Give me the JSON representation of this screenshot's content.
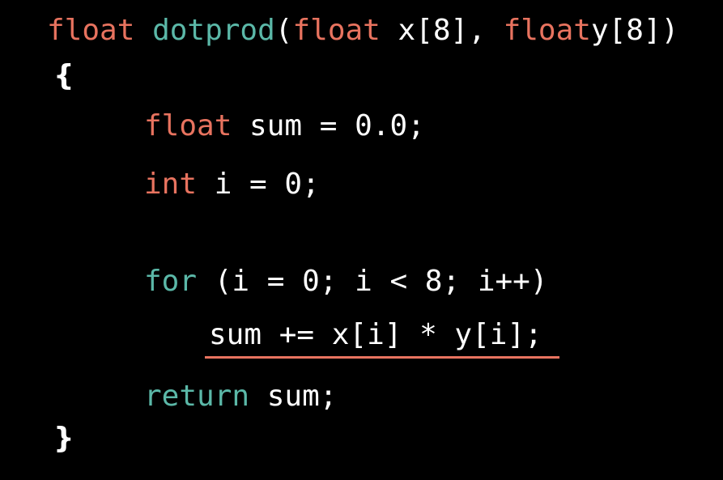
{
  "code": {
    "line1": {
      "kw_float_1": "float",
      "fn_name": "dotprod",
      "paren_open": "(",
      "kw_float_2": "float",
      "param_x": " x[8],",
      "kw_float_3": "float",
      "param_y": "y[8])"
    },
    "line2": {
      "brace_open": "{"
    },
    "line3": {
      "kw_float": "float",
      "rest": " sum = 0.0;"
    },
    "line4": {
      "kw_int": "int",
      "rest": " i = 0;"
    },
    "line5": {
      "kw_for": "for",
      "rest": " (i = 0; i < 8; i++)"
    },
    "line6": {
      "text": "sum += x[i] * y[i];"
    },
    "line7": {
      "kw_return": "return",
      "rest": " sum;"
    },
    "line8": {
      "brace_close": "}"
    }
  },
  "colors": {
    "keyword_type": "#e8735f",
    "keyword_control": "#5bb8a8",
    "text": "#ffffff",
    "background": "#000000",
    "highlight_underline": "#e8735f"
  }
}
